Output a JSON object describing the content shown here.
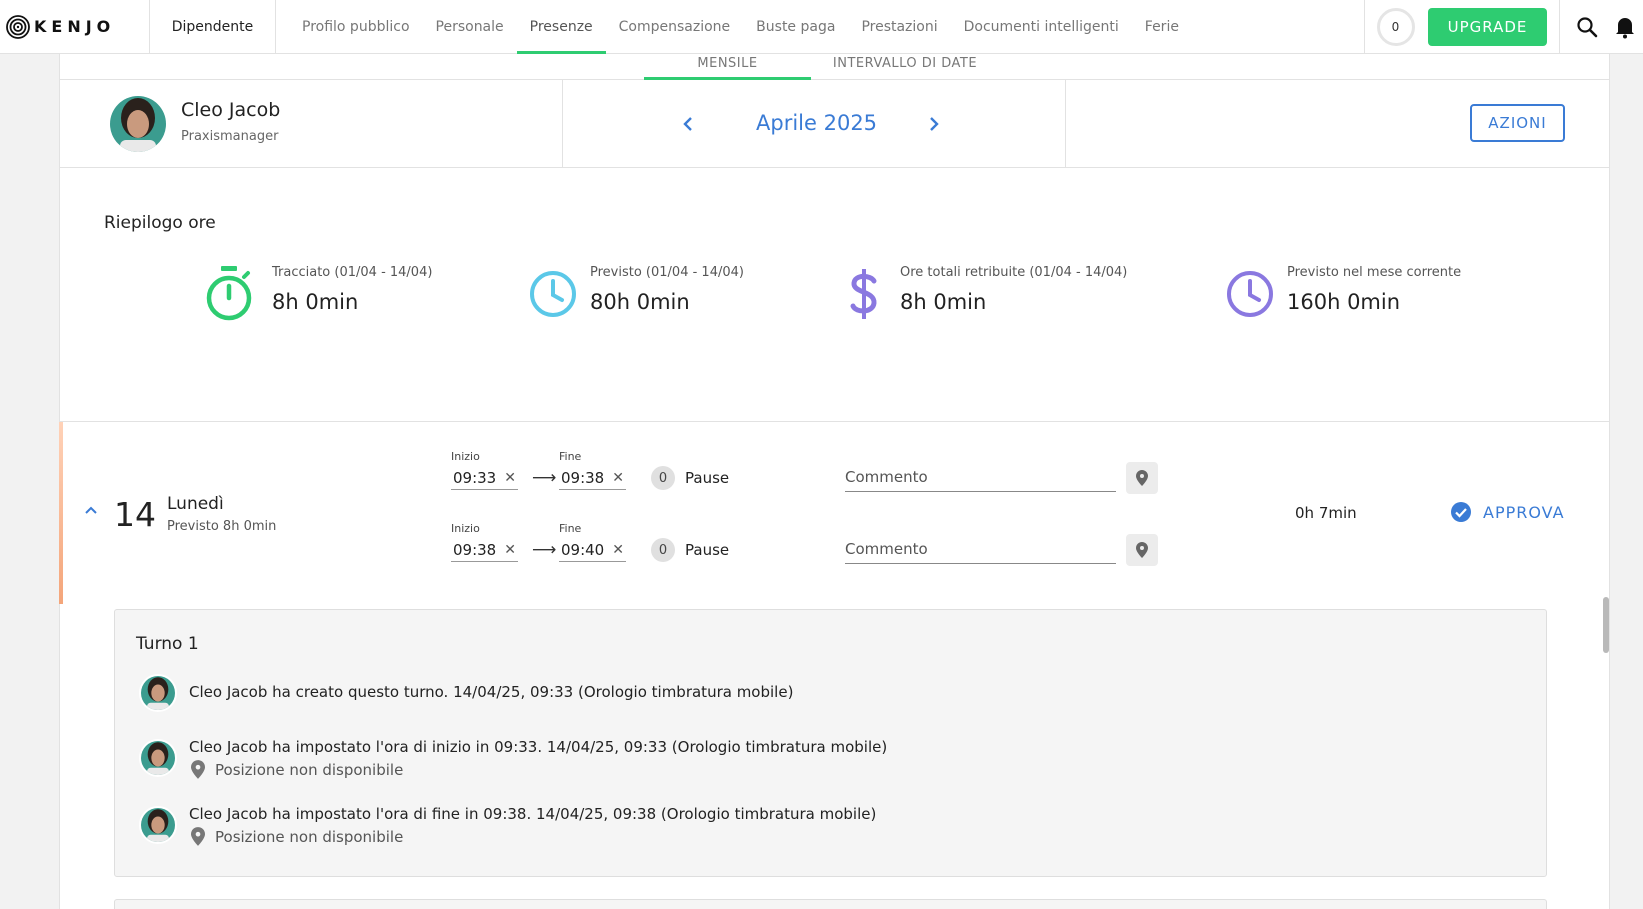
{
  "nav": {
    "logo_text": "KENJO",
    "employee_tab": "Dipendente",
    "tabs": [
      {
        "label": "Profilo pubblico"
      },
      {
        "label": "Personale"
      },
      {
        "label": "Presenze",
        "active": true
      },
      {
        "label": "Compensazione"
      },
      {
        "label": "Buste paga"
      },
      {
        "label": "Prestazioni"
      },
      {
        "label": "Documenti intelligenti"
      },
      {
        "label": "Ferie"
      }
    ],
    "counter": "0",
    "upgrade_label": "UPGRADE",
    "icons": [
      "search-icon",
      "bell-icon"
    ]
  },
  "subtabs": {
    "monthly": "MENSILE",
    "date_range": "INTERVALLO DI DATE"
  },
  "employee": {
    "name": "Cleo Jacob",
    "role": "Praxismanager"
  },
  "period": {
    "label": "Aprile 2025"
  },
  "actions_label": "AZIONI",
  "summary": {
    "title": "Riepilogo ore",
    "metrics": [
      {
        "icon": "stopwatch-icon",
        "color": "#2ecc71",
        "label": "Tracciato (01/04 - 14/04)",
        "value": "8h 0min"
      },
      {
        "icon": "clock-icon",
        "color": "#5bc8e8",
        "label": "Previsto (01/04 - 14/04)",
        "value": "80h 0min"
      },
      {
        "icon": "dollar-icon",
        "color": "#8a78e0",
        "label": "Ore totali retribuite (01/04 - 14/04)",
        "value": "8h 0min"
      },
      {
        "icon": "clock-icon",
        "color": "#8a78e0",
        "label": "Previsto nel mese corrente",
        "value": "160h 0min"
      }
    ]
  },
  "day": {
    "number": "14",
    "name": "Lunedì",
    "planned": "Previsto 8h 0min",
    "total": "0h 7min",
    "approve_label": "APPROVA",
    "shifts": [
      {
        "start_label": "Inizio",
        "start": "09:33",
        "end_label": "Fine",
        "end": "09:38",
        "pauses": "0",
        "pause_label": "Pause",
        "comment_placeholder": "Commento"
      },
      {
        "start_label": "Inizio",
        "start": "09:38",
        "end_label": "Fine",
        "end": "09:40",
        "pauses": "0",
        "pause_label": "Pause",
        "comment_placeholder": "Commento"
      }
    ]
  },
  "log": {
    "title": "Turno 1",
    "entries": [
      {
        "text": "Cleo Jacob ha creato questo turno.  14/04/25, 09:33  (Orologio timbratura mobile)",
        "sub": ""
      },
      {
        "text": "Cleo Jacob ha impostato l'ora di inizio in 09:33.  14/04/25, 09:33  (Orologio timbratura mobile)",
        "sub": "Posizione non disponibile"
      },
      {
        "text": "Cleo Jacob ha impostato l'ora di fine in 09:38.  14/04/25, 09:38  (Orologio timbratura mobile)",
        "sub": "Posizione non disponibile"
      }
    ]
  },
  "colors": {
    "accent_green": "#2ecc71",
    "accent_blue": "#3a7bd5"
  }
}
